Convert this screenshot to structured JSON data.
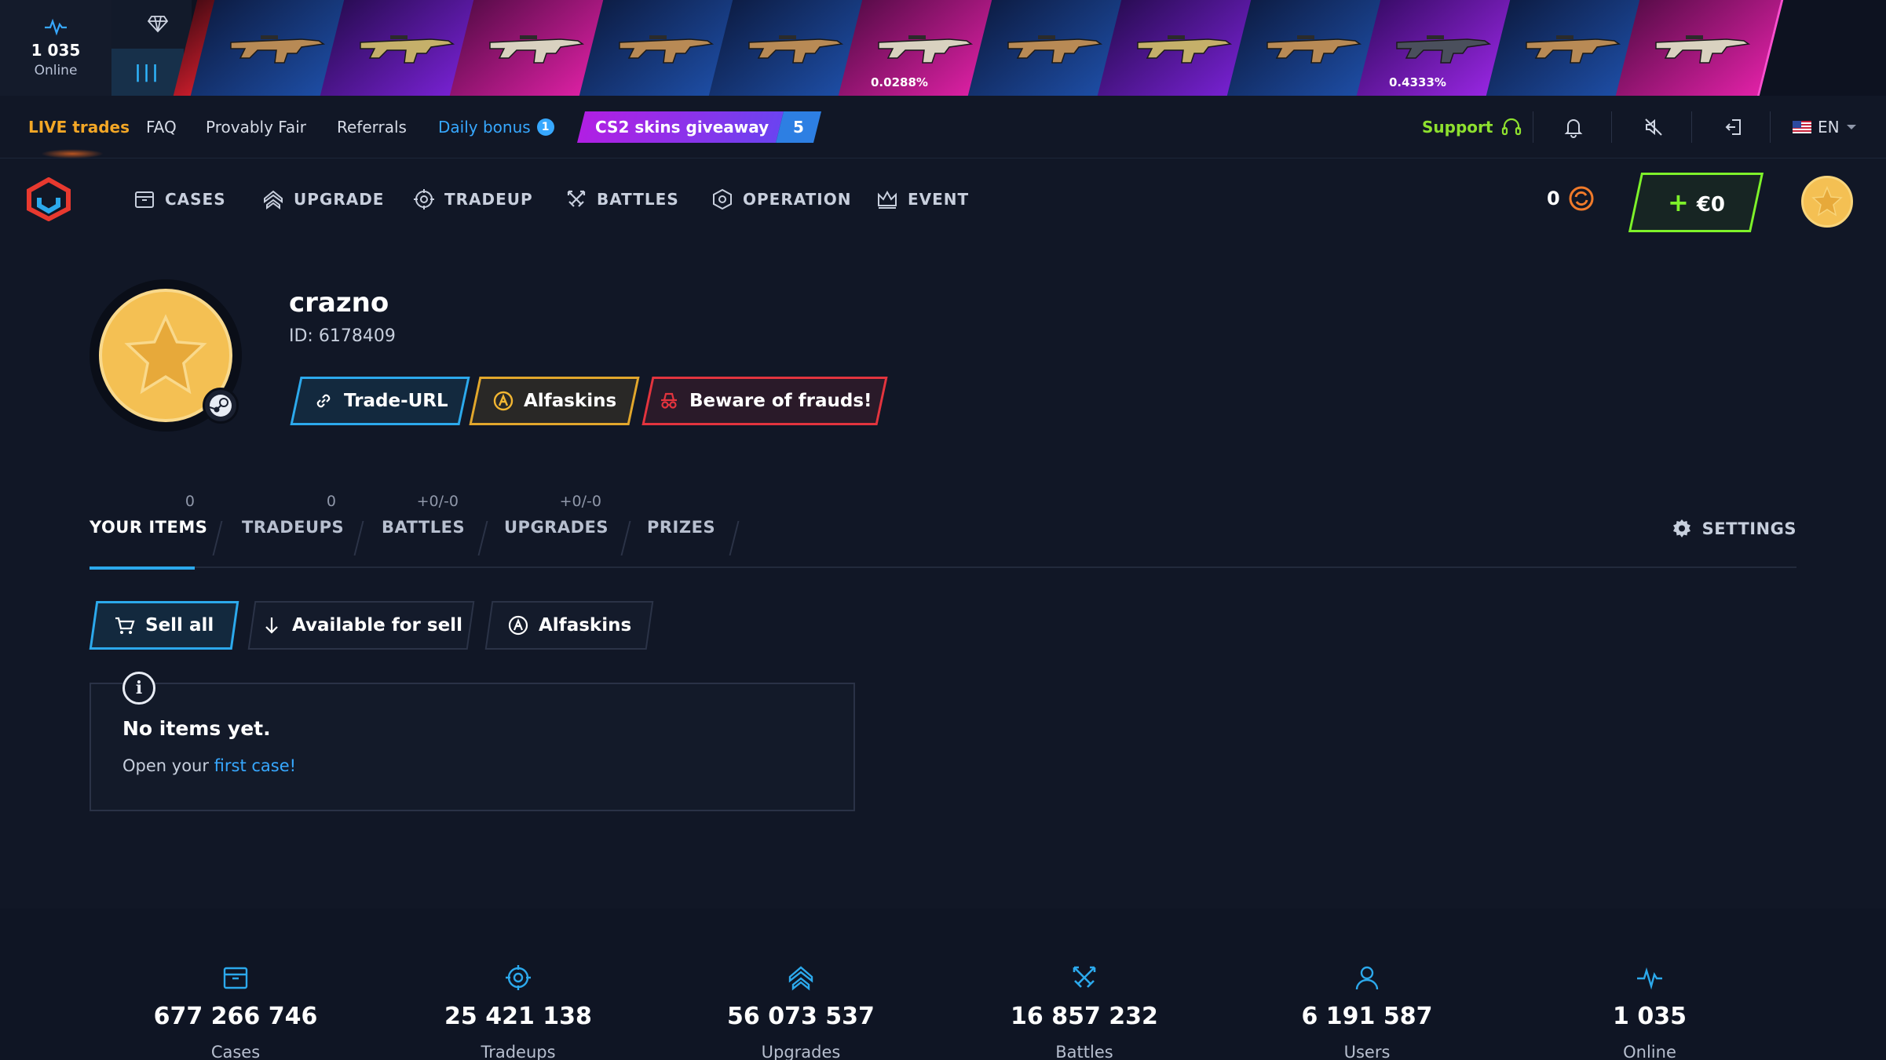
{
  "live_strip": {
    "online_count": "1 035",
    "online_label": "Online",
    "drops": [
      {
        "rarity": "red",
        "percent": ""
      },
      {
        "rarity": "blue",
        "percent": ""
      },
      {
        "rarity": "purple",
        "percent": ""
      },
      {
        "rarity": "pink",
        "percent": ""
      },
      {
        "rarity": "blue",
        "percent": ""
      },
      {
        "rarity": "blue",
        "percent": ""
      },
      {
        "rarity": "pink",
        "percent": "0.0288%"
      },
      {
        "rarity": "blue",
        "percent": ""
      },
      {
        "rarity": "purple",
        "percent": ""
      },
      {
        "rarity": "blue",
        "percent": ""
      },
      {
        "rarity": "violet",
        "percent": "0.4333%"
      },
      {
        "rarity": "blue",
        "percent": ""
      },
      {
        "rarity": "pink",
        "percent": ""
      }
    ]
  },
  "topnav": {
    "live_trades": "LIVE trades",
    "faq": "FAQ",
    "provably_fair": "Provably Fair",
    "referrals": "Referrals",
    "daily_bonus": "Daily bonus",
    "daily_bonus_count": "1",
    "giveaway_label": "CS2 skins giveaway",
    "giveaway_count": "5",
    "support": "Support",
    "language": "EN"
  },
  "mainnav": {
    "cases": "CASES",
    "upgrade": "UPGRADE",
    "tradeup": "TRADEUP",
    "battles": "BATTLES",
    "operation": "OPERATION",
    "event": "EVENT",
    "coins": "0",
    "deposit_plus": "+",
    "deposit_amount": "€0"
  },
  "profile": {
    "username": "crazno",
    "user_id": "ID: 6178409",
    "trade_url": "Trade-URL",
    "alfaskins": "Alfaskins",
    "beware": "Beware of frauds!"
  },
  "tabs": {
    "items": [
      {
        "label": "YOUR ITEMS",
        "count": "0"
      },
      {
        "label": "TRADEUPS",
        "count": "0"
      },
      {
        "label": "BATTLES",
        "count": "+0/-0"
      },
      {
        "label": "UPGRADES",
        "count": "+0/-0"
      },
      {
        "label": "PRIZES",
        "count": ""
      }
    ],
    "settings": "SETTINGS"
  },
  "actions": {
    "sell_all": "Sell all",
    "available": "Available for sell",
    "alfaskins": "Alfaskins"
  },
  "empty": {
    "info_glyph": "i",
    "title": "No items yet.",
    "sub_prefix": "Open your ",
    "sub_link": "first case!"
  },
  "stats": [
    {
      "icon": "case-icon",
      "value": "677 266 746",
      "label": "Cases"
    },
    {
      "icon": "tradeup-icon",
      "value": "25 421 138",
      "label": "Tradeups"
    },
    {
      "icon": "upgrade-icon",
      "value": "56 073 537",
      "label": "Upgrades"
    },
    {
      "icon": "battles-icon",
      "value": "16 857 232",
      "label": "Battles"
    },
    {
      "icon": "user-icon",
      "value": "6 191 587",
      "label": "Users"
    },
    {
      "icon": "pulse-icon",
      "value": "1 035",
      "label": "Online"
    }
  ],
  "colors": {
    "accent_blue": "#2ca9ec",
    "accent_green": "#7ef22a",
    "accent_orange": "#f3a726",
    "accent_red": "#e3343e",
    "avatar_gold": "#f4c053"
  }
}
